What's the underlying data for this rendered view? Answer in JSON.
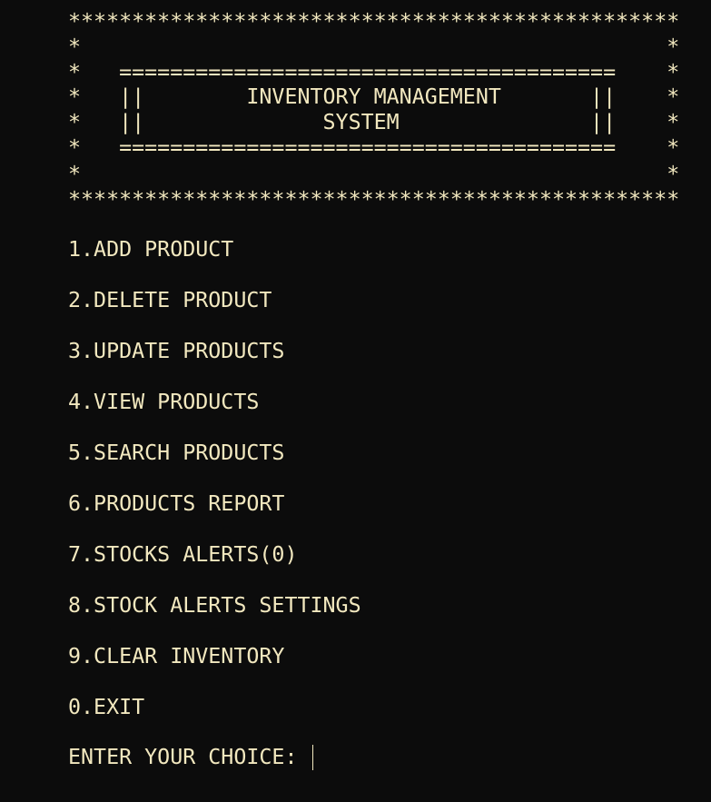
{
  "banner": {
    "border_top": "************************************************",
    "blank_1": "*                                              *",
    "rule_1": "*   =======================================    *",
    "title_line_1": "*   ||        INVENTORY MANAGEMENT       ||    *",
    "title_line_2": "*   ||              SYSTEM               ||    *",
    "rule_2": "*   =======================================    *",
    "blank_2": "*                                              *",
    "border_bottom": "************************************************"
  },
  "menu": {
    "items": [
      "1.ADD PRODUCT",
      "2.DELETE PRODUCT",
      "3.UPDATE PRODUCTS",
      "4.VIEW PRODUCTS",
      "5.SEARCH PRODUCTS",
      "6.PRODUCTS REPORT",
      "7.STOCKS ALERTS(0)",
      "8.STOCK ALERTS SETTINGS",
      "9.CLEAR INVENTORY",
      "0.EXIT"
    ]
  },
  "prompt": {
    "label": "ENTER YOUR CHOICE: ",
    "value": ""
  },
  "colors": {
    "background": "#0c0c0c",
    "text": "#f2e8bf"
  }
}
